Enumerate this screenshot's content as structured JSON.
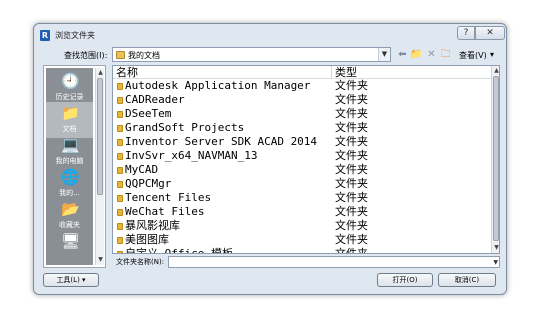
{
  "window": {
    "title": "浏览文件夹",
    "app_icon_letter": "R",
    "help_label": "?",
    "close_label": "✕"
  },
  "toolbar": {
    "lookin_label": "查找范围(I):",
    "lookin_value": "我的文档",
    "view_label": "查看(V)",
    "view_arrow": "▾",
    "icons": [
      "back-icon",
      "up-folder-icon",
      "delete-icon",
      "new-folder-icon"
    ]
  },
  "places": [
    {
      "label": "历史记录",
      "icon": "history-icon",
      "glyph": "🕘",
      "selected": false
    },
    {
      "label": "文档",
      "icon": "documents-icon",
      "glyph": "📁",
      "selected": true
    },
    {
      "label": "我的电脑",
      "icon": "computer-icon",
      "glyph": "💻",
      "selected": false
    },
    {
      "label": "我的...",
      "icon": "network-icon",
      "glyph": "🌐",
      "selected": false
    },
    {
      "label": "收藏夹",
      "icon": "favorites-icon",
      "glyph": "📂",
      "selected": false
    },
    {
      "label": "",
      "icon": "desktop-icon",
      "glyph": "🖥",
      "selected": false
    }
  ],
  "list": {
    "columns": {
      "name": "名称",
      "type": "类型"
    },
    "rows": [
      {
        "name": "Autodesk Application Manager",
        "type": "文件夹"
      },
      {
        "name": "CADReader",
        "type": "文件夹"
      },
      {
        "name": "DSeeTem",
        "type": "文件夹"
      },
      {
        "name": "GrandSoft Projects",
        "type": "文件夹"
      },
      {
        "name": "Inventor Server SDK ACAD 2014",
        "type": "文件夹"
      },
      {
        "name": "InvSvr_x64_NAVMAN_13",
        "type": "文件夹"
      },
      {
        "name": "MyCAD",
        "type": "文件夹"
      },
      {
        "name": "QQPCMgr",
        "type": "文件夹"
      },
      {
        "name": "Tencent Files",
        "type": "文件夹"
      },
      {
        "name": "WeChat Files",
        "type": "文件夹"
      },
      {
        "name": "暴风影视库",
        "type": "文件夹"
      },
      {
        "name": "美图图库",
        "type": "文件夹"
      },
      {
        "name": "自定义 Office 模板",
        "type": "文件夹"
      }
    ]
  },
  "filename": {
    "label": "文件夹名称(N):",
    "value": ""
  },
  "buttons": {
    "tools": "工具(L)  ▾",
    "open": "打开(O)",
    "cancel": "取消(C)"
  }
}
